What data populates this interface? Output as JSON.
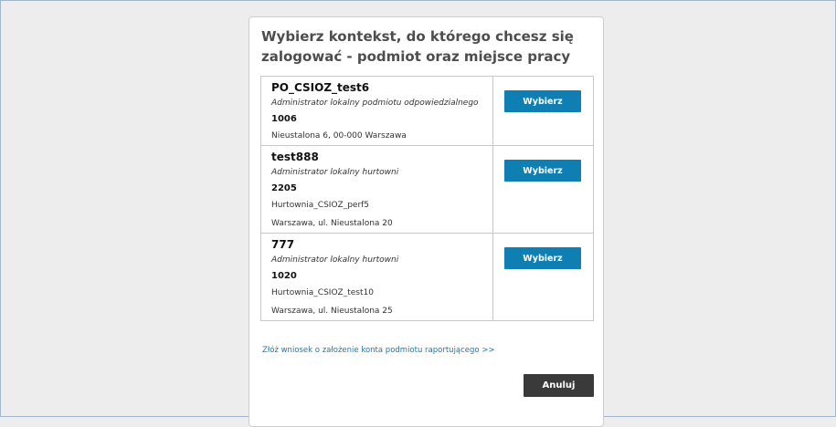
{
  "dialog": {
    "title": "Wybierz kontekst, do którego chcesz się zalogować - podmiot oraz miejsce pracy",
    "choose_label": "Wybierz",
    "link_label": "Złóż wniosek o założenie konta podmiotu raportującego >>",
    "cancel_label": "Anuluj"
  },
  "entries": [
    {
      "name": "PO_CSIOZ_test6",
      "role": "Administrator lokalny podmiotu odpowiedzialnego",
      "code": "1006",
      "lines": [
        "Nieustalona 6, 00-000 Warszawa"
      ]
    },
    {
      "name": "test888",
      "role": "Administrator lokalny hurtowni",
      "code": "2205",
      "lines": [
        "Hurtownia_CSIOZ_perf5",
        "Warszawa, ul. Nieustalona 20"
      ]
    },
    {
      "name": "777",
      "role": "Administrator lokalny hurtowni",
      "code": "1020",
      "lines": [
        "Hurtownia_CSIOZ_test10",
        "Warszawa, ul. Nieustalona 25"
      ]
    }
  ]
}
